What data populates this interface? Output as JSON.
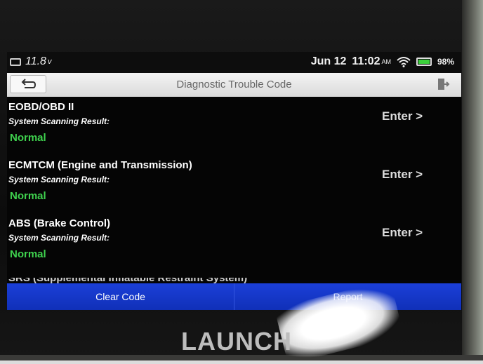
{
  "status": {
    "voltage": "11.8",
    "voltage_unit": "v",
    "date": "Jun 12",
    "time": "11:02",
    "ampm": "AM",
    "battery_percent": "98%",
    "battery_level": 0.98
  },
  "titlebar": {
    "title": "Diagnostic Trouble Code"
  },
  "systems": [
    {
      "name": "EOBD/OBD II",
      "sub": "System Scanning Result:",
      "status": "Normal",
      "enter_label": "Enter >"
    },
    {
      "name": "ECMTCM (Engine and Transmission)",
      "sub": "System Scanning Result:",
      "status": "Normal",
      "enter_label": "Enter >"
    },
    {
      "name": "ABS (Brake Control)",
      "sub": "System Scanning Result:",
      "status": "Normal",
      "enter_label": "Enter >"
    }
  ],
  "clipped_item": "SRS (Supplemental Inflatable Restraint System)",
  "bottombar": {
    "clear_code_label": "Clear Code",
    "report_label": "Report"
  },
  "device": {
    "logo": "LAUNCH"
  },
  "colors": {
    "accent": "#1b3fd8",
    "status_normal": "#3fd24e"
  }
}
